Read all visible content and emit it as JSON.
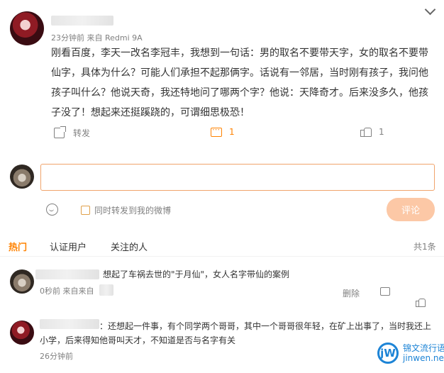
{
  "post": {
    "meta": "23分钟前  来自 Redmi 9A",
    "text": "刚看百度，李天一改名李冠丰，我想到一句话：男的取名不要带天字，女的取名不要带仙字，具体为什么？可能人们承担不起那俩字。话说有一邻居，当时刚有孩子，我问他孩子叫什么？他说天奇，我还特地问了哪两个字？他说：天降奇才。后来没多久，他孩子没了！想起来还挺蹊跷的，可谓细思极恐！",
    "repost_label": "转发",
    "comment_count": "1",
    "like_count": "1"
  },
  "composer": {
    "placeholder": "",
    "also_repost_label": "同时转发到我的微博",
    "submit_label": "评论"
  },
  "tabs": [
    "热门",
    "认证用户",
    "关注的人"
  ],
  "total_label": "共1条",
  "comments": [
    {
      "text": "想起了车祸去世的\"于月仙\"，女人名字带仙的案例",
      "meta": "0秒前  来自来自",
      "delete_label": "删除"
    },
    {
      "text": "：还想起一件事，有个同学两个哥哥，其中一个哥哥很年轻，在矿上出事了，当时我还上小学，后来得知他哥叫天才，不知道是否与名字有关",
      "meta": "26分钟前"
    }
  ],
  "watermark": {
    "logo": "jW",
    "line1": "锦文流行语",
    "line2": "jinwen.net"
  },
  "colors": {
    "accent": "#ff8200",
    "button_disabled": "#fcc8a6",
    "watermark_blue": "#1d84d6"
  },
  "icons": [
    "chevron-down-icon",
    "repost-icon",
    "comment-icon",
    "like-icon",
    "emoji-icon",
    "checkbox-icon"
  ]
}
